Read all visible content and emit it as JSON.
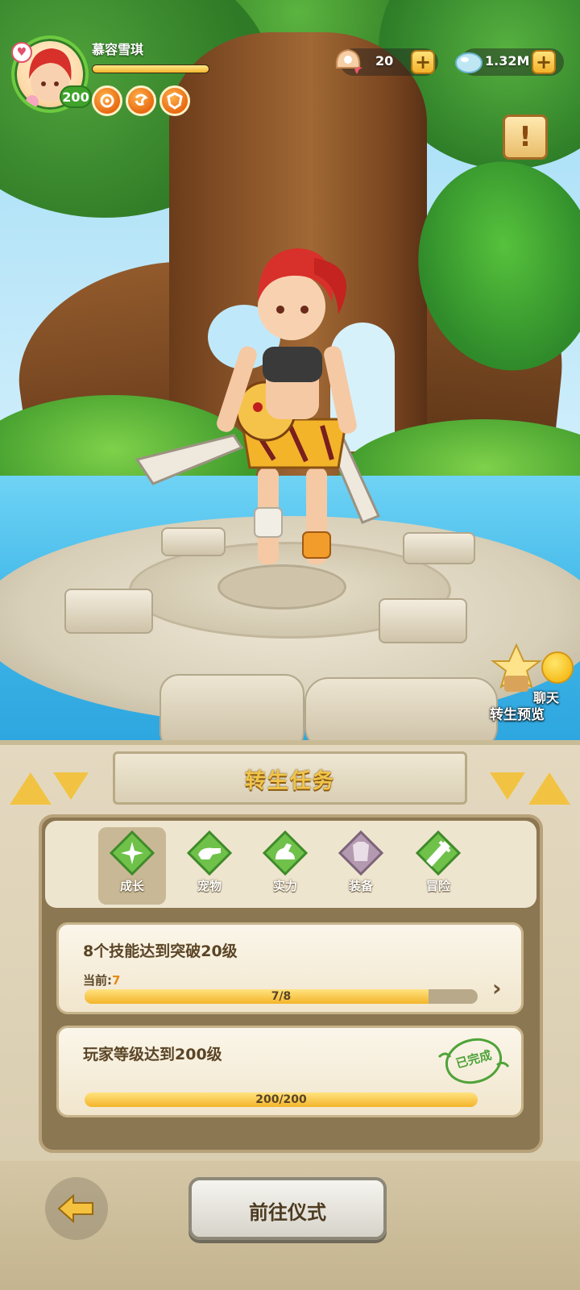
{
  "player": {
    "name": "慕容雪琪",
    "level": "200",
    "exp_progress": 1.0
  },
  "resources": {
    "shells": "20",
    "gems": "1.32M"
  },
  "scene": {
    "rebirth_preview_label": "转生预览",
    "chat_label": "聊天"
  },
  "panel": {
    "title": "转生任务",
    "tabs": [
      {
        "label": "成长",
        "icon": "star-icon",
        "selected": true
      },
      {
        "label": "宠物",
        "icon": "dino-icon",
        "selected": false
      },
      {
        "label": "实力",
        "icon": "arm-icon",
        "selected": false
      },
      {
        "label": "装备",
        "icon": "armor-icon",
        "selected": false
      },
      {
        "label": "冒险",
        "icon": "adventure-icon",
        "selected": false
      }
    ],
    "tasks": [
      {
        "title": "8个技能达到突破20级",
        "current_label": "当前:",
        "current_value": "7",
        "progress_text": "7/8",
        "progress": 0.875,
        "completed": false
      },
      {
        "title": "玩家等级达到200级",
        "progress_text": "200/200",
        "progress": 1.0,
        "completed": true,
        "stamp": "已完成"
      }
    ],
    "go_button": "前往仪式"
  },
  "colors": {
    "title_gold": "#f0c54a",
    "progress_fill": "#f4b42a",
    "completed_green": "#4fa33a",
    "accent_orange": "#e48a1c"
  }
}
